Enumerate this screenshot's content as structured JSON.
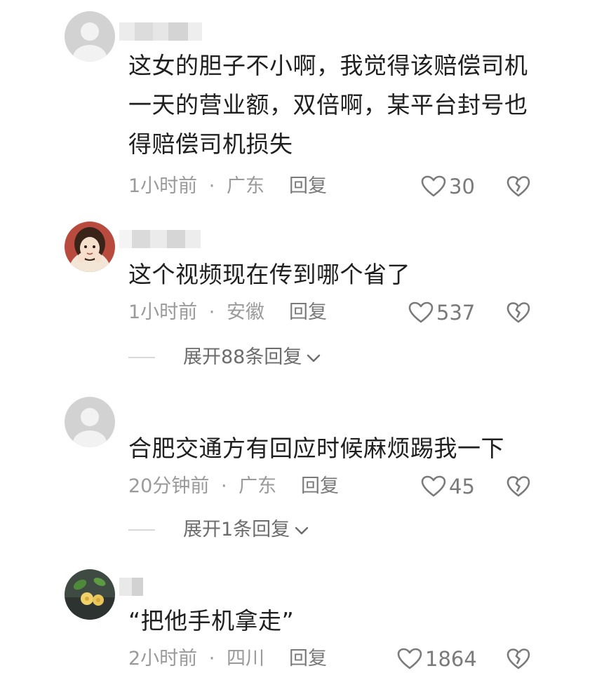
{
  "comments": [
    {
      "text": "这女的胆子不小啊，我觉得该赔偿司机一天的营业额，双倍啊，某平台封号也得赔偿司机损失",
      "time": "1小时前",
      "location": "广东",
      "reply_label": "回复",
      "likes": "30",
      "avatar": "default-avatar-icon"
    },
    {
      "text": "这个视频现在传到哪个省了",
      "time": "1小时前",
      "location": "安徽",
      "reply_label": "回复",
      "likes": "537",
      "expand_label": "展开88条回复",
      "avatar": "anime-girl-avatar"
    },
    {
      "text": "合肥交通方有回应时候麻烦踢我一下",
      "time": "20分钟前",
      "location": "广东",
      "reply_label": "回复",
      "likes": "45",
      "expand_label": "展开1条回复",
      "avatar": "default-avatar-icon"
    },
    {
      "text": "“把他手机拿走”",
      "time": "2小时前",
      "location": "四川",
      "reply_label": "回复",
      "likes": "1864",
      "avatar": "flower-photo-avatar"
    }
  ],
  "separator": "·",
  "colors": {
    "text": "#1f1f1f",
    "meta": "#9a9a9a",
    "icon": "#7a7a7a"
  }
}
